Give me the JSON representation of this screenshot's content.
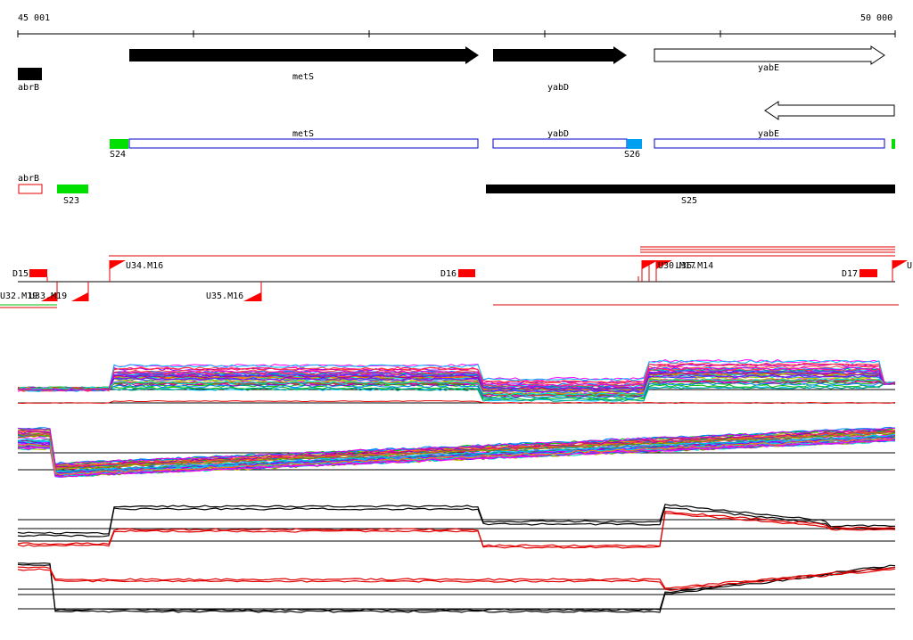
{
  "ruler": {
    "start_label": "45 001",
    "end_label": "50 000"
  },
  "genes": [
    {
      "name": "abrB"
    },
    {
      "name": "metS"
    },
    {
      "name": "yabD"
    },
    {
      "name": "yabE"
    }
  ],
  "gene_models": [
    {
      "name": "metS"
    },
    {
      "name": "yabD"
    },
    {
      "name": "yabE"
    }
  ],
  "segments": [
    {
      "label": "S24",
      "color": "#00e000"
    },
    {
      "label": "S26",
      "color": "#00a0f0"
    },
    {
      "label": "S23",
      "color": "#00e000"
    },
    {
      "label": "S25",
      "color": "#000000"
    }
  ],
  "promoters": [
    {
      "label": "D15"
    },
    {
      "label": "U34.M16"
    },
    {
      "label": "D16"
    },
    {
      "label": "U36.M14"
    },
    {
      "label": "U30.M17"
    },
    {
      "label": "D17"
    },
    {
      "label": "U"
    },
    {
      "label": "U32.M19"
    },
    {
      "label": "U33.M19"
    },
    {
      "label": "U35.M16"
    }
  ],
  "colors": {
    "forward": "#000000",
    "open": "#ffffff",
    "model_border": "#0000cc",
    "promoter": "#ff0000"
  }
}
